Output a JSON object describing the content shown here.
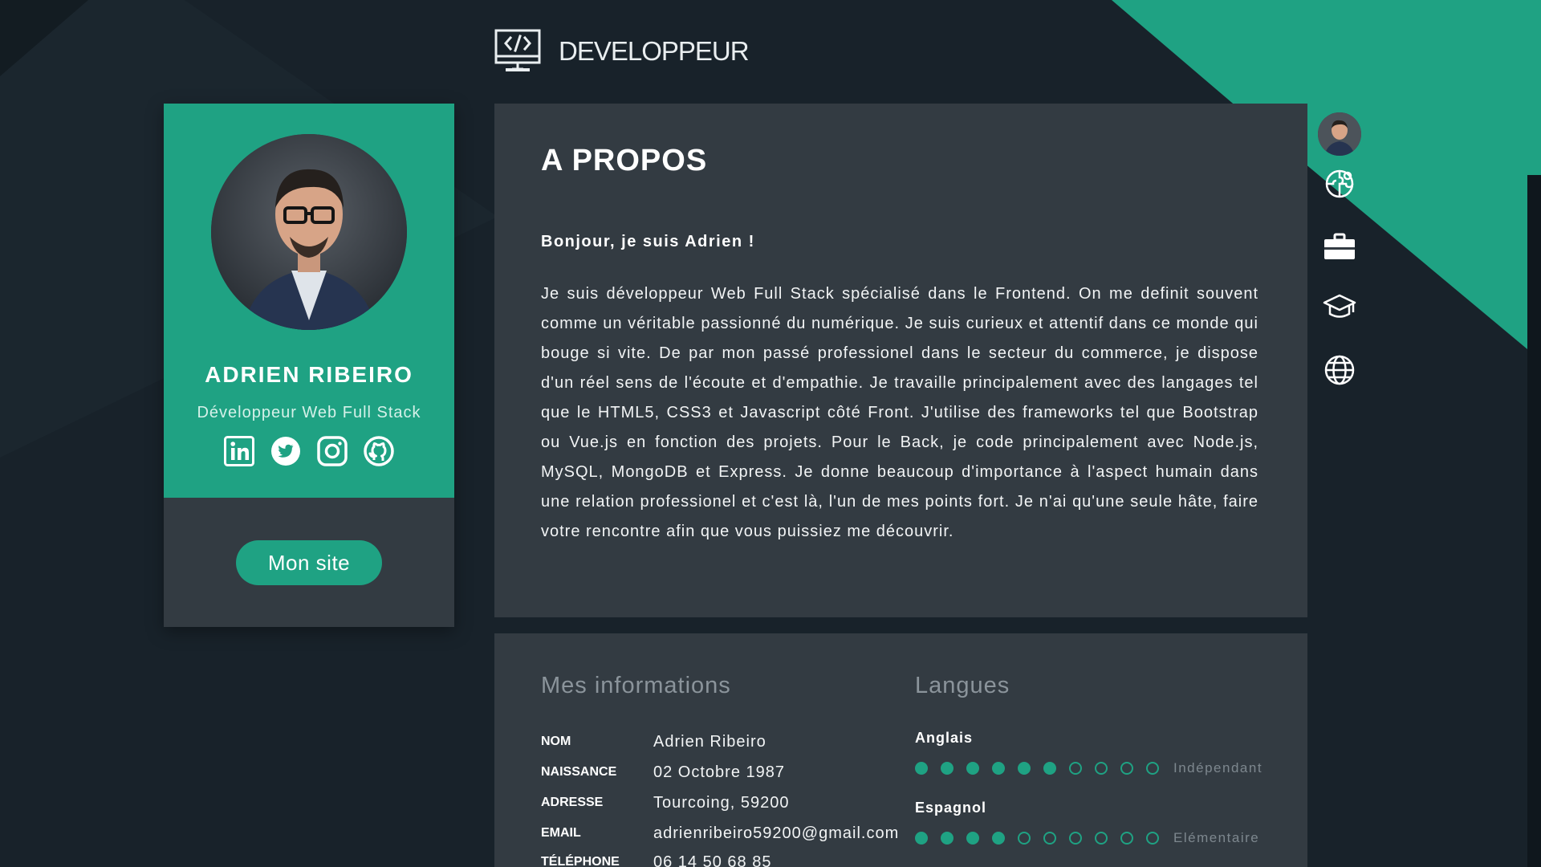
{
  "brand": {
    "title": "DEVELOPPEUR"
  },
  "colors": {
    "accent": "#1fa283",
    "panel": "#333b42",
    "background": "#18222a"
  },
  "profile": {
    "name": "ADRIEN RIBEIRO",
    "role": "Développeur Web Full Stack",
    "socials": [
      "linkedin-icon",
      "twitter-icon",
      "instagram-icon",
      "github-icon"
    ],
    "site_button": "Mon site"
  },
  "about": {
    "title": "A PROPOS",
    "greeting": "Bonjour, je suis Adrien !",
    "body": "Je suis développeur Web Full Stack spécialisé dans le Frontend. On me definit souvent comme un véritable passionné du numérique. Je suis curieux et attentif dans ce monde qui bouge si vite. De par mon passé professionel dans le secteur du commerce, je dispose d'un réel sens de l'écoute et d'empathie. Je travaille principalement avec des langages tel que le HTML5, CSS3 et Javascript côté Front. J'utilise des frameworks tel que Bootstrap ou Vue.js en fonction des projets. Pour le Back, je code principalement avec Node.js, MySQL, MongoDB et Express. Je donne beaucoup d'importance à l'aspect humain dans une relation professionel et c'est là, l'un de mes points fort. Je n'ai qu'une seule hâte, faire votre rencontre afin que vous puissiez me découvrir."
  },
  "info": {
    "title": "Mes informations",
    "rows": [
      {
        "key": "NOM",
        "value": "Adrien Ribeiro"
      },
      {
        "key": "NAISSANCE",
        "value": "02 Octobre 1987"
      },
      {
        "key": "ADRESSE",
        "value": "Tourcoing, 59200"
      },
      {
        "key": "EMAIL",
        "value": "adrienribeiro59200@gmail.com"
      },
      {
        "key": "TÉLÉPHONE",
        "value": "06 14 50 68 85"
      }
    ]
  },
  "languages": {
    "title": "Langues",
    "items": [
      {
        "name": "Anglais",
        "level": "Indépendant",
        "filled": 6,
        "total": 10
      },
      {
        "name": "Espagnol",
        "level": "Elémentaire",
        "filled": 4,
        "total": 10
      }
    ]
  },
  "nav": {
    "icons": [
      "profile-avatar",
      "puzzle-icon",
      "briefcase-icon",
      "graduation-cap-icon",
      "globe-icon"
    ]
  },
  "scrollbar": {
    "position": 0
  }
}
